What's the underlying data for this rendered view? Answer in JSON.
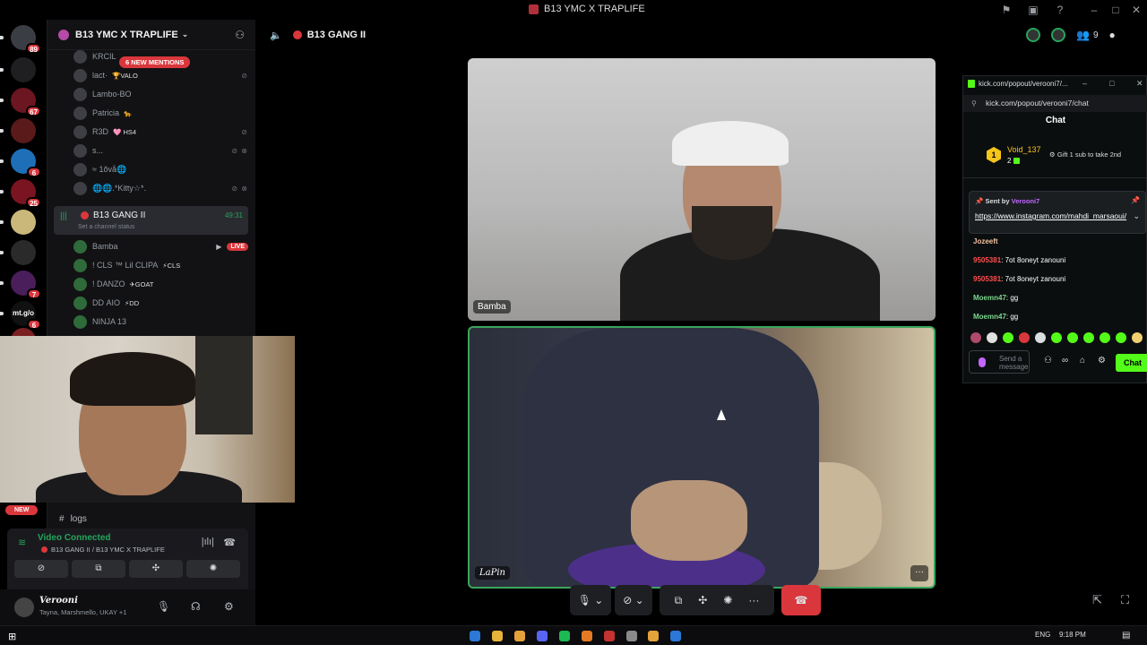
{
  "window": {
    "title": "B13 YMC X TRAPLIFE"
  },
  "guilds": [
    {
      "label": "",
      "badge": "89",
      "color": "#3a3d44"
    },
    {
      "label": "",
      "badge": "",
      "color": "#1f1f22"
    },
    {
      "label": "",
      "badge": "67",
      "color": "#6b1620"
    },
    {
      "label": "",
      "badge": "",
      "color": "#5a1a1a"
    },
    {
      "label": "",
      "badge": "6",
      "color": "#1e6fb8"
    },
    {
      "label": "",
      "badge": "25",
      "color": "#7a1420"
    },
    {
      "label": "",
      "badge": "",
      "color": "#c9b87a"
    },
    {
      "label": "",
      "badge": "",
      "color": "#2a2a2a"
    },
    {
      "label": "",
      "badge": "7",
      "color": "#4a1e5a"
    },
    {
      "label": "mt.g/o",
      "badge": "6",
      "color": "#111"
    },
    {
      "label": "",
      "badge": "",
      "color": "#7a2020"
    }
  ],
  "server": {
    "name": "B13 YMC X TRAPLIFE",
    "new_mentions": "6 NEW MENTIONS"
  },
  "voice_users_top": [
    {
      "name": "KRCIL",
      "tag": ""
    },
    {
      "name": "lact·",
      "tag": "🏆VALO"
    },
    {
      "name": "Lambo-BO",
      "tag": ""
    },
    {
      "name": "Patricia",
      "tag": "🐆"
    },
    {
      "name": "R3D",
      "tag": "🩷 HS4"
    },
    {
      "name": "s...",
      "tag": ""
    },
    {
      "name": "≈ 1ŏvå🌐",
      "tag": ""
    },
    {
      "name": "🌐🌐.*Kitty☆*.",
      "tag": ""
    }
  ],
  "voice_channel": {
    "name": "B13 GANG II",
    "status": "Set a channel status",
    "time": "49:31"
  },
  "voice_members": [
    {
      "name": "Bamba",
      "tag": "",
      "live": "LIVE"
    },
    {
      "name": "! CLS ™ Lil CLIPA",
      "tag": "⚡CLS",
      "live": ""
    },
    {
      "name": "! DANZO",
      "tag": "✈GOAT",
      "live": ""
    },
    {
      "name": "DD ΑΙΟ",
      "tag": "⚡DD",
      "live": ""
    },
    {
      "name": "NINJA 13",
      "tag": "",
      "live": ""
    }
  ],
  "text_channel": {
    "name": "logs",
    "new_label": "NEW"
  },
  "voice_panel": {
    "status": "Video Connected",
    "location": "B13 GANG II / B13 YMC X TRAPLIFE"
  },
  "user": {
    "name": "Verooni",
    "status": "Tayna, Marshmello, UKAY +1"
  },
  "call": {
    "channel": "B13 GANG II",
    "participant_count": "9"
  },
  "tiles": [
    {
      "name": "Bamba"
    },
    {
      "name": "LaPin"
    }
  ],
  "kick": {
    "window_title": "kick.com/popout/verooni7/...",
    "url": "kick.com/popout/verooni7/chat",
    "header": "Chat",
    "gifter": {
      "rank": "1",
      "name": "Void_137",
      "count": "2",
      "sub_text": "Gift 1 sub to take 2nd"
    },
    "pinned": {
      "sent_by": "Sent by",
      "author": "Verooni7",
      "link": "https://www.instagram.com/mahdi_marsaoui/"
    },
    "messages": [
      {
        "user": "Jozeeft",
        "text": "",
        "color": "#f2c0a0"
      },
      {
        "user": "9505381",
        "text": ": 7ot 8oneyt zanouni",
        "color": "#ff4d4d"
      },
      {
        "user": "9505381",
        "text": ": 7ot 8oneyt zanouni",
        "color": "#ff4d4d"
      },
      {
        "user": "Moemn47",
        "text": ": gg",
        "color": "#7bd88f"
      },
      {
        "user": "Moemn47",
        "text": ": gg",
        "color": "#7bd88f"
      }
    ],
    "input_placeholder": "Send a message",
    "chat_button": "Chat"
  },
  "taskbar": {
    "lang": "ENG",
    "time": "9:18 PM"
  },
  "colors": {
    "accent_green": "#23a55a",
    "danger": "#da373c",
    "kick_green": "#53fc18"
  }
}
